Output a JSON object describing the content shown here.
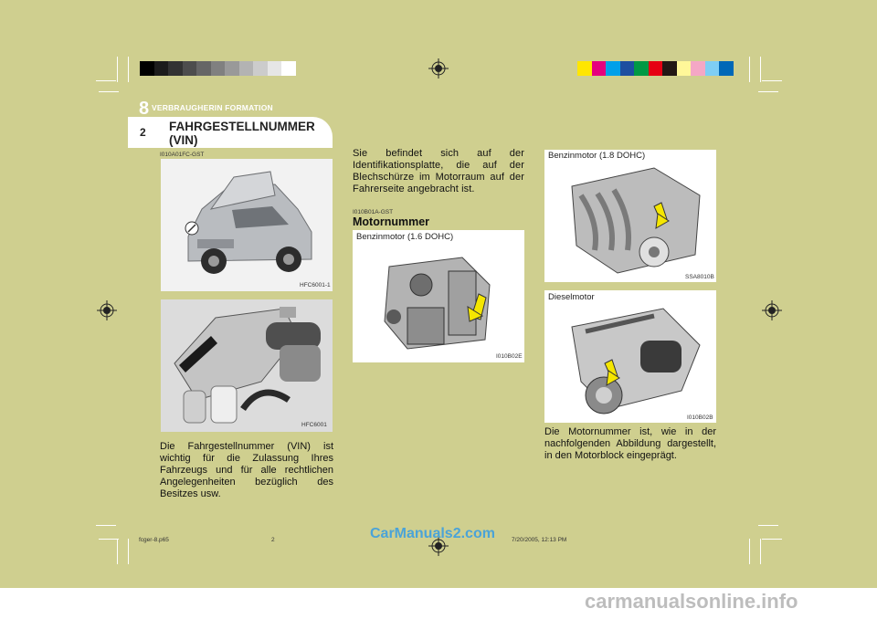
{
  "header": {
    "chapter_number": "8",
    "chapter_title": "VERBRAUGHERIN FORMATION",
    "page_number": "2",
    "section_title": "FAHRGESTELLNUMMER (VIN)"
  },
  "left_column": {
    "section_code": "I010A01FC-GST",
    "image1_label": "HFC6001-1",
    "image2_label": "HFC6001",
    "paragraph": "Die Fahrgestellnummer (VIN) ist wichtig für die Zulassung Ihres Fahrzeugs und für alle rechtlichen Angelegenheiten bezüglich des Besitzes usw."
  },
  "middle_column": {
    "paragraph": "Sie befindet sich auf der Identifikationsplatte, die auf der Blechschürze im Motorraum auf der Fahrerseite angebracht ist.",
    "sub_code": "I010B01A-GST",
    "sub_title": "Motornummer",
    "image_caption": "Benzinmotor (1.6 DOHC)",
    "image_label": "I010B02E"
  },
  "right_column": {
    "image1_caption": "Benzinmotor (1.8 DOHC)",
    "image1_label": "SSA8010B",
    "image2_caption": "Dieselmotor",
    "image2_label": "I010B02B",
    "paragraph": "Die Motornummer ist, wie in der nachfolgenden Abbildung dargestellt, in den Motorblock eingeprägt."
  },
  "footer": {
    "file_name": "fcger-8.p65",
    "page": "2",
    "timestamp": "7/20/2005, 12:13 PM",
    "watermark_top": "CarManuals2.com",
    "watermark_bottom": "carmanualsonline.info"
  },
  "colors": {
    "background": "#cfcf8f",
    "gray_swatches": [
      "#000000",
      "#1c1c1c",
      "#333333",
      "#4d4d4d",
      "#666666",
      "#808080",
      "#999999",
      "#b3b3b3",
      "#cccccc",
      "#e6e6e6",
      "#ffffff"
    ],
    "color_swatches": [
      "#ffe600",
      "#e6007e",
      "#00a0e9",
      "#1d4fa0",
      "#009944",
      "#e60012",
      "#231815",
      "#fff799",
      "#f4a7c5",
      "#7ecef4",
      "#0068b7"
    ],
    "highlight_arrow": "#f5e600"
  }
}
